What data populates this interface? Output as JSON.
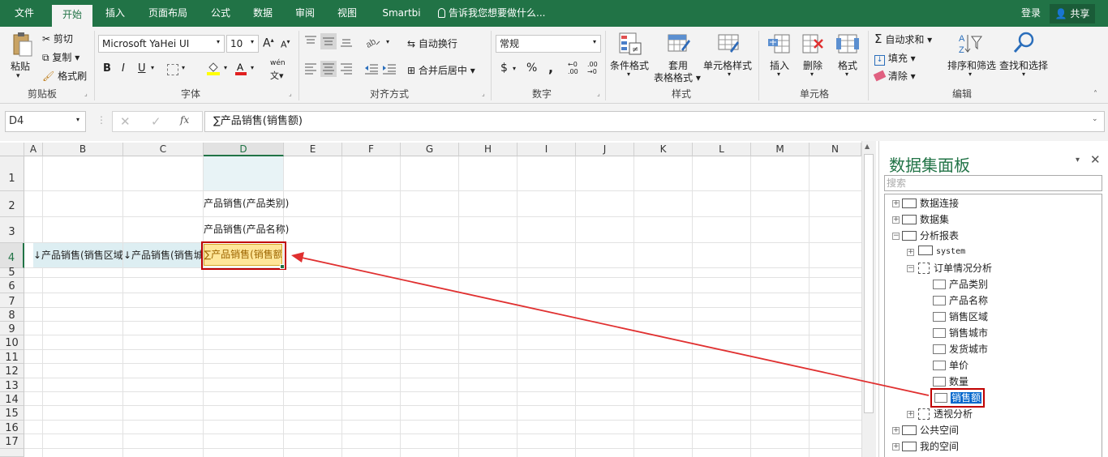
{
  "tabs": [
    "文件",
    "开始",
    "插入",
    "页面布局",
    "公式",
    "数据",
    "审阅",
    "视图",
    "Smartbi"
  ],
  "tell_me": "告诉我您想要做什么...",
  "login": "登录",
  "share": "共享",
  "clipboard": {
    "paste": "粘贴",
    "cut": "剪切",
    "copy": "复制",
    "format_painter": "格式刷",
    "label": "剪贴板"
  },
  "font": {
    "name": "Microsoft YaHei UI",
    "size": "10",
    "bold": "B",
    "italic": "I",
    "underline": "U",
    "grow": "A",
    "shrink": "A",
    "wen": "wén",
    "label": "字体"
  },
  "alignment": {
    "wrap": "自动换行",
    "merge": "合并后居中",
    "label": "对齐方式"
  },
  "number": {
    "format": "常规",
    "currency": "$",
    "percent": "%",
    "comma": ",",
    "label": "数字"
  },
  "styles": {
    "conditional": "条件格式",
    "table_line1": "套用",
    "table_line2": "表格格式",
    "cell_styles": "单元格样式",
    "label": "样式"
  },
  "cells": {
    "insert": "插入",
    "delete": "删除",
    "format": "格式",
    "label": "单元格"
  },
  "editing": {
    "autosum": "自动求和",
    "fill": "填充",
    "clear": "清除",
    "sort": "排序和筛选",
    "find": "查找和选择",
    "label": "编辑"
  },
  "formula_bar": {
    "name_box": "D4",
    "fx": "fx",
    "formula": "∑产品销售(销售额)"
  },
  "columns": [
    "A",
    "B",
    "C",
    "D",
    "E",
    "F",
    "G",
    "H",
    "I",
    "J",
    "K",
    "L",
    "M",
    "N"
  ],
  "rows": [
    "1",
    "2",
    "3",
    "4",
    "5",
    "6",
    "7",
    "8",
    "9",
    "10",
    "11",
    "12",
    "13",
    "14",
    "15",
    "16",
    "17"
  ],
  "cells_data": {
    "d2": "产品销售(产品类别)",
    "d3": "产品销售(产品名称)",
    "b4": "↓产品销售(销售区域)",
    "c4": "↓产品销售(销售城市)",
    "d4": "∑产品销售(销售额)"
  },
  "panel": {
    "title": "数据集面板",
    "search_placeholder": "搜索",
    "tree": [
      "数据连接",
      "数据集",
      "分析报表",
      "system",
      "订单情况分析",
      "产品类别",
      "产品名称",
      "销售区域",
      "销售城市",
      "发货城市",
      "单价",
      "数量",
      "销售额",
      "透视分析",
      "公共空间",
      "我的空间"
    ]
  },
  "colors": {
    "accent": "#217346",
    "highlight": "#ffe699",
    "selected": "#0066cc",
    "arrow": "#e03030"
  }
}
